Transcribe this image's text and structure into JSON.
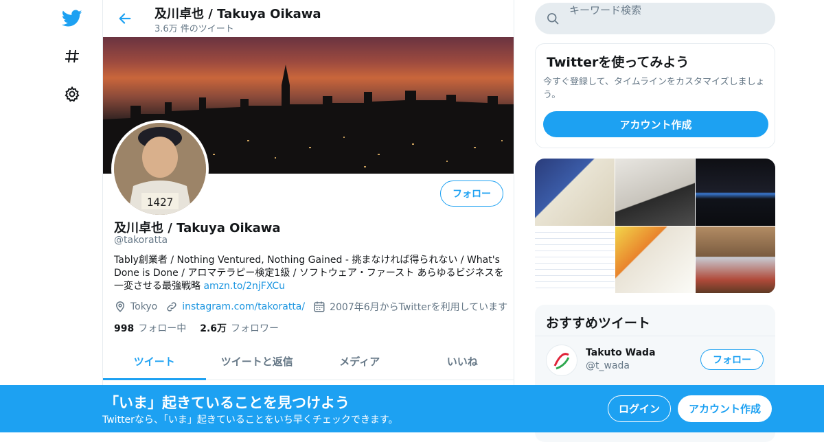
{
  "nav": {
    "icons": [
      "twitter-bird-icon",
      "hashtag-icon",
      "settings-gear-icon"
    ]
  },
  "header": {
    "name": "及川卓也 / Takuya Oikawa",
    "tweet_count": "3.6万 件のツイート"
  },
  "profile": {
    "follow_label": "フォロー",
    "name": "及川卓也 / Takuya Oikawa",
    "handle": "@takoratta",
    "bio_text": "Tably創業者 / Nothing Ventured, Nothing Gained - 挑まなければ得られない / What's Done is Done / アロマテラピー検定1級 / ソフトウェア・ファースト あらゆるビジネスを一変させる最強戦略 ",
    "bio_link": "amzn.to/2njFXCu",
    "location": "Tokyo",
    "website": "instagram.com/takoratta/",
    "joined": "2007年6月からTwitterを利用しています",
    "following_count": "998",
    "following_label": "フォロー中",
    "followers_count": "2.6万",
    "followers_label": "フォロワー"
  },
  "tabs": [
    {
      "label": "ツイート",
      "active": true
    },
    {
      "label": "ツイートと返信",
      "active": false
    },
    {
      "label": "メディア",
      "active": false
    },
    {
      "label": "いいね",
      "active": false
    }
  ],
  "search": {
    "placeholder": "キーワード検索"
  },
  "signup_card": {
    "title": "Twitterを使ってみよう",
    "description": "今すぐ登録して、タイムラインをカスタマイズしましょう。",
    "button": "アカウント作成"
  },
  "recommended": {
    "title": "おすすめツイート",
    "user_name": "Takuto Wada",
    "user_handle": "@t_wada",
    "follow_label": "フォロー"
  },
  "bottom_banner": {
    "title": "「いま」起きていることを見つけよう",
    "subtitle": "Twitterなら、「いま」起きていることをいち早くチェックできます。",
    "login": "ログイン",
    "signup": "アカウント作成"
  },
  "colors": {
    "accent": "#1da1f2",
    "text": "#14171a",
    "muted": "#657786"
  }
}
